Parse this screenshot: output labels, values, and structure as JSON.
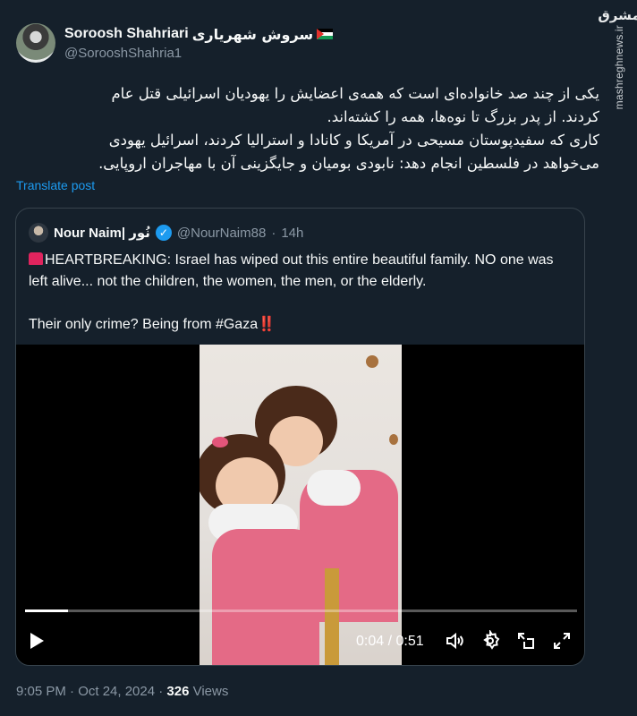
{
  "watermark": {
    "logo": "مشرق",
    "url": "mashreghnews.ir"
  },
  "author": {
    "name": "Soroosh Shahriari",
    "name_fa": "سروش شهریاری",
    "handle": "@SorooshShahria1"
  },
  "post": {
    "lines": [
      "یکی از چند صد خانواده‌ای است که همه‌ی اعضایش را یهودیان اسرائیلی قتل عام",
      "کردند. از پدر بزرگ تا نوه‌ها، همه را کشته‌اند.",
      "کاری که سفیدپوستان مسیحی در آمریکا و کانادا و استرالیا کردند، اسرائیل یهودی",
      "می‌خواهد در فلسطین انجام دهد: نابودی بومیان و جایگزینی آن با مهاجران اروپایی."
    ],
    "translate_label": "Translate post"
  },
  "quoted": {
    "name": "Nour Naim| نُور",
    "handle": "@NourNaim88",
    "separator": "·",
    "age": "14h",
    "verified_mark": "✓",
    "text_line1": "HEARTBREAKING: Israel has wiped out this entire beautiful family. NO one was left alive... not the children, the women, the men, or the elderly.",
    "text_line2": "Their only crime? Being from #Gaza",
    "bangs": "‼️"
  },
  "video": {
    "time": "0:04 / 0:51",
    "progress": 0.078
  },
  "footer": {
    "time": "9:05 PM · Oct 24, 2024 · ",
    "views_count": "326",
    "views_label": " Views"
  },
  "icons": {
    "play": "play-icon",
    "volume": "volume-icon",
    "settings": "gear-icon",
    "pip": "picture-in-picture-icon",
    "fullscreen": "fullscreen-icon"
  }
}
